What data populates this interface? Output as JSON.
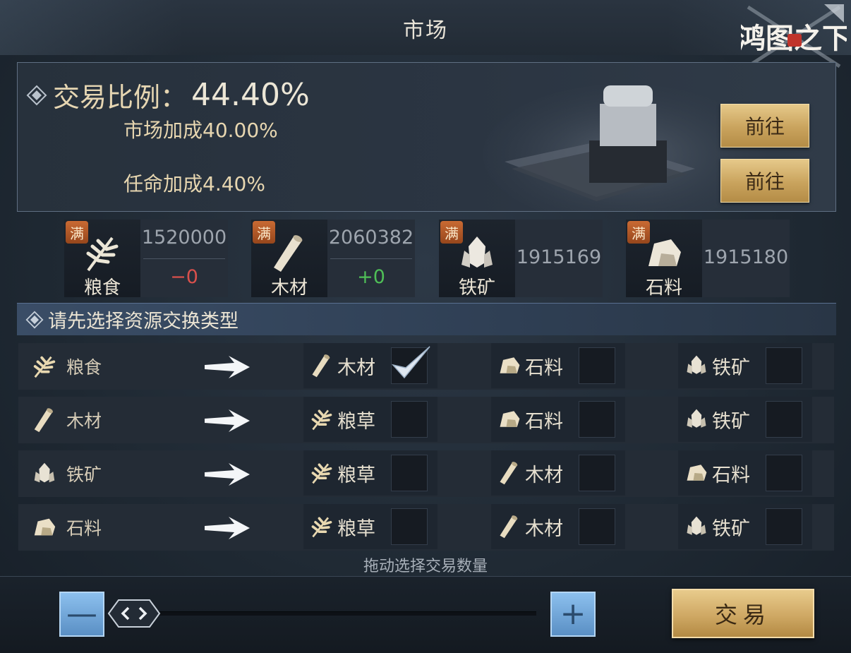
{
  "window": {
    "title": "市场",
    "logo_text": "鸿图之下"
  },
  "banner": {
    "ratio_label": "交易比例：",
    "ratio_value": "44.40%",
    "market_bonus": "市场加成40.00%",
    "appoint_bonus": "任命加成4.40%",
    "goto_label_1": "前往",
    "goto_label_2": "前往"
  },
  "resources": [
    {
      "name": "粮食",
      "badge": "满",
      "amount": "1520000",
      "delta": "−0",
      "icon": "grain-icon"
    },
    {
      "name": "木材",
      "badge": "满",
      "amount": "2060382",
      "delta": "+0",
      "icon": "wood-icon"
    },
    {
      "name": "铁矿",
      "badge": "满",
      "amount": "1915169",
      "icon": "iron-icon"
    },
    {
      "name": "石料",
      "badge": "满",
      "amount": "1915180",
      "icon": "stone-icon"
    }
  ],
  "section": {
    "title": "请先选择资源交换类型"
  },
  "exchange_rows": [
    {
      "source": "粮食",
      "targets": [
        "木材",
        "石料",
        "铁矿"
      ],
      "checked": [
        true,
        false,
        false
      ]
    },
    {
      "source": "木材",
      "targets": [
        "粮草",
        "石料",
        "铁矿"
      ],
      "checked": [
        false,
        false,
        false
      ]
    },
    {
      "source": "铁矿",
      "targets": [
        "粮草",
        "木材",
        "石料"
      ],
      "checked": [
        false,
        false,
        false
      ]
    },
    {
      "source": "石料",
      "targets": [
        "粮草",
        "木材",
        "铁矿"
      ],
      "checked": [
        false,
        false,
        false
      ]
    }
  ],
  "footer": {
    "hint": "拖动选择交易数量",
    "minus_symbol": "—",
    "plus_symbol": "+",
    "trade_label": "交易"
  },
  "colors": {
    "gold_button": "#cfa864",
    "blue_button": "#5a8fc4",
    "delta_negative": "#d9504c",
    "delta_positive": "#4fbf57",
    "badge": "#c96a33"
  }
}
